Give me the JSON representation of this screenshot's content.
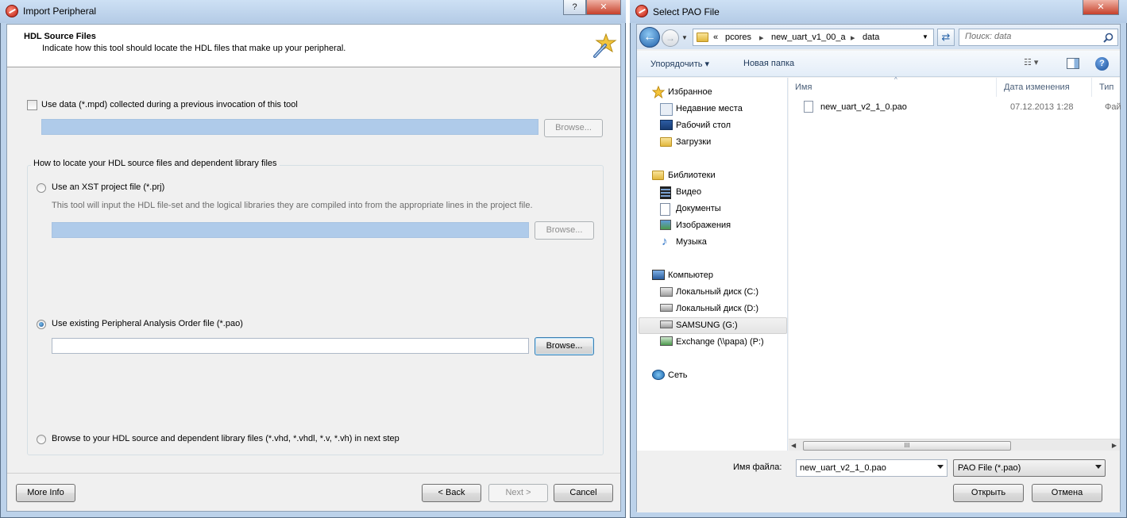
{
  "left": {
    "title": "Import Peripheral",
    "header": {
      "title": "HDL Source Files",
      "subtitle": "Indicate how this tool should locate the HDL files that make up your peripheral."
    },
    "use_data_label": "Use data (*.mpd) collected during a previous invocation of this tool",
    "browse_label": "Browse...",
    "group_caption": "How to locate your HDL source files and dependent library files",
    "opt_xst_label": "Use an XST project file (*.prj)",
    "opt_xst_hint": "This tool will input the HDL file-set and the logical libraries they are compiled into from the appropriate lines in the project file.",
    "opt_pao_label": "Use existing Peripheral Analysis Order file (*.pao)",
    "opt_browse_label": "Browse to your HDL source and dependent library files (*.vhd, *.vhdl, *.v, *.vh) in next step",
    "buttons": {
      "more_info": "More Info",
      "back": "< Back",
      "next": "Next >",
      "cancel": "Cancel"
    }
  },
  "right": {
    "title": "Select PAO File",
    "address": [
      "«",
      "pcores",
      "new_uart_v1_00_a",
      "data"
    ],
    "search_placeholder": "Поиск: data",
    "toolbar": {
      "organize": "Упорядочить",
      "new_folder": "Новая папка"
    },
    "nav": {
      "favorites": "Избранное",
      "fav_items": [
        "Недавние места",
        "Рабочий стол",
        "Загрузки"
      ],
      "libraries": "Библиотеки",
      "lib_items": [
        "Видео",
        "Документы",
        "Изображения",
        "Музыка"
      ],
      "computer": "Компьютер",
      "comp_items": [
        "Локальный диск (C:)",
        "Локальный диск (D:)",
        "SAMSUNG (G:)",
        "Exchange (\\\\papa) (P:)"
      ],
      "network": "Сеть"
    },
    "columns": {
      "name": "Имя",
      "date": "Дата изменения",
      "type": "Тип"
    },
    "files": [
      {
        "name": "new_uart_v2_1_0.pao",
        "date": "07.12.2013 1:28",
        "type": "Фай"
      }
    ],
    "filename_label": "Имя файла:",
    "filename_value": "new_uart_v2_1_0.pao",
    "filter": "PAO File (*.pao)",
    "buttons": {
      "open": "Открыть",
      "cancel": "Отмена"
    },
    "scroll_grip": "III"
  },
  "colors": {
    "accent": "#3c7fb1",
    "disabled_field": "#afcbea",
    "frame": "#bcd2ea"
  }
}
